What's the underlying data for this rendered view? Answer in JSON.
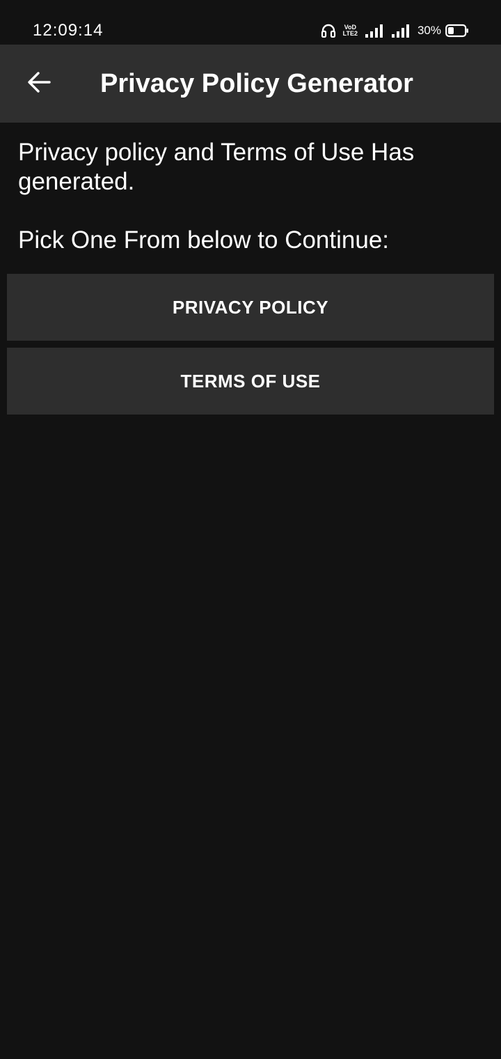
{
  "status_bar": {
    "time": "12:09:14",
    "volte_line1": "VoD",
    "volte_line2": "LTE2",
    "battery_percent": "30%",
    "icons": [
      "headphones-icon",
      "volte-icon",
      "signal-icon",
      "signal-icon",
      "battery-icon"
    ]
  },
  "app_bar": {
    "back_icon": "arrow-left-icon",
    "title": "Privacy Policy Generator"
  },
  "content": {
    "message_line1": "Privacy policy and Terms of Use Has generated.",
    "message_line2": "Pick One From below to Continue:"
  },
  "buttons": {
    "privacy_policy": "PRIVACY POLICY",
    "terms_of_use": "TERMS OF USE"
  },
  "colors": {
    "background": "#121212",
    "app_bar": "#2f2f2f",
    "button": "#2e2e2e",
    "text": "#ffffff"
  }
}
